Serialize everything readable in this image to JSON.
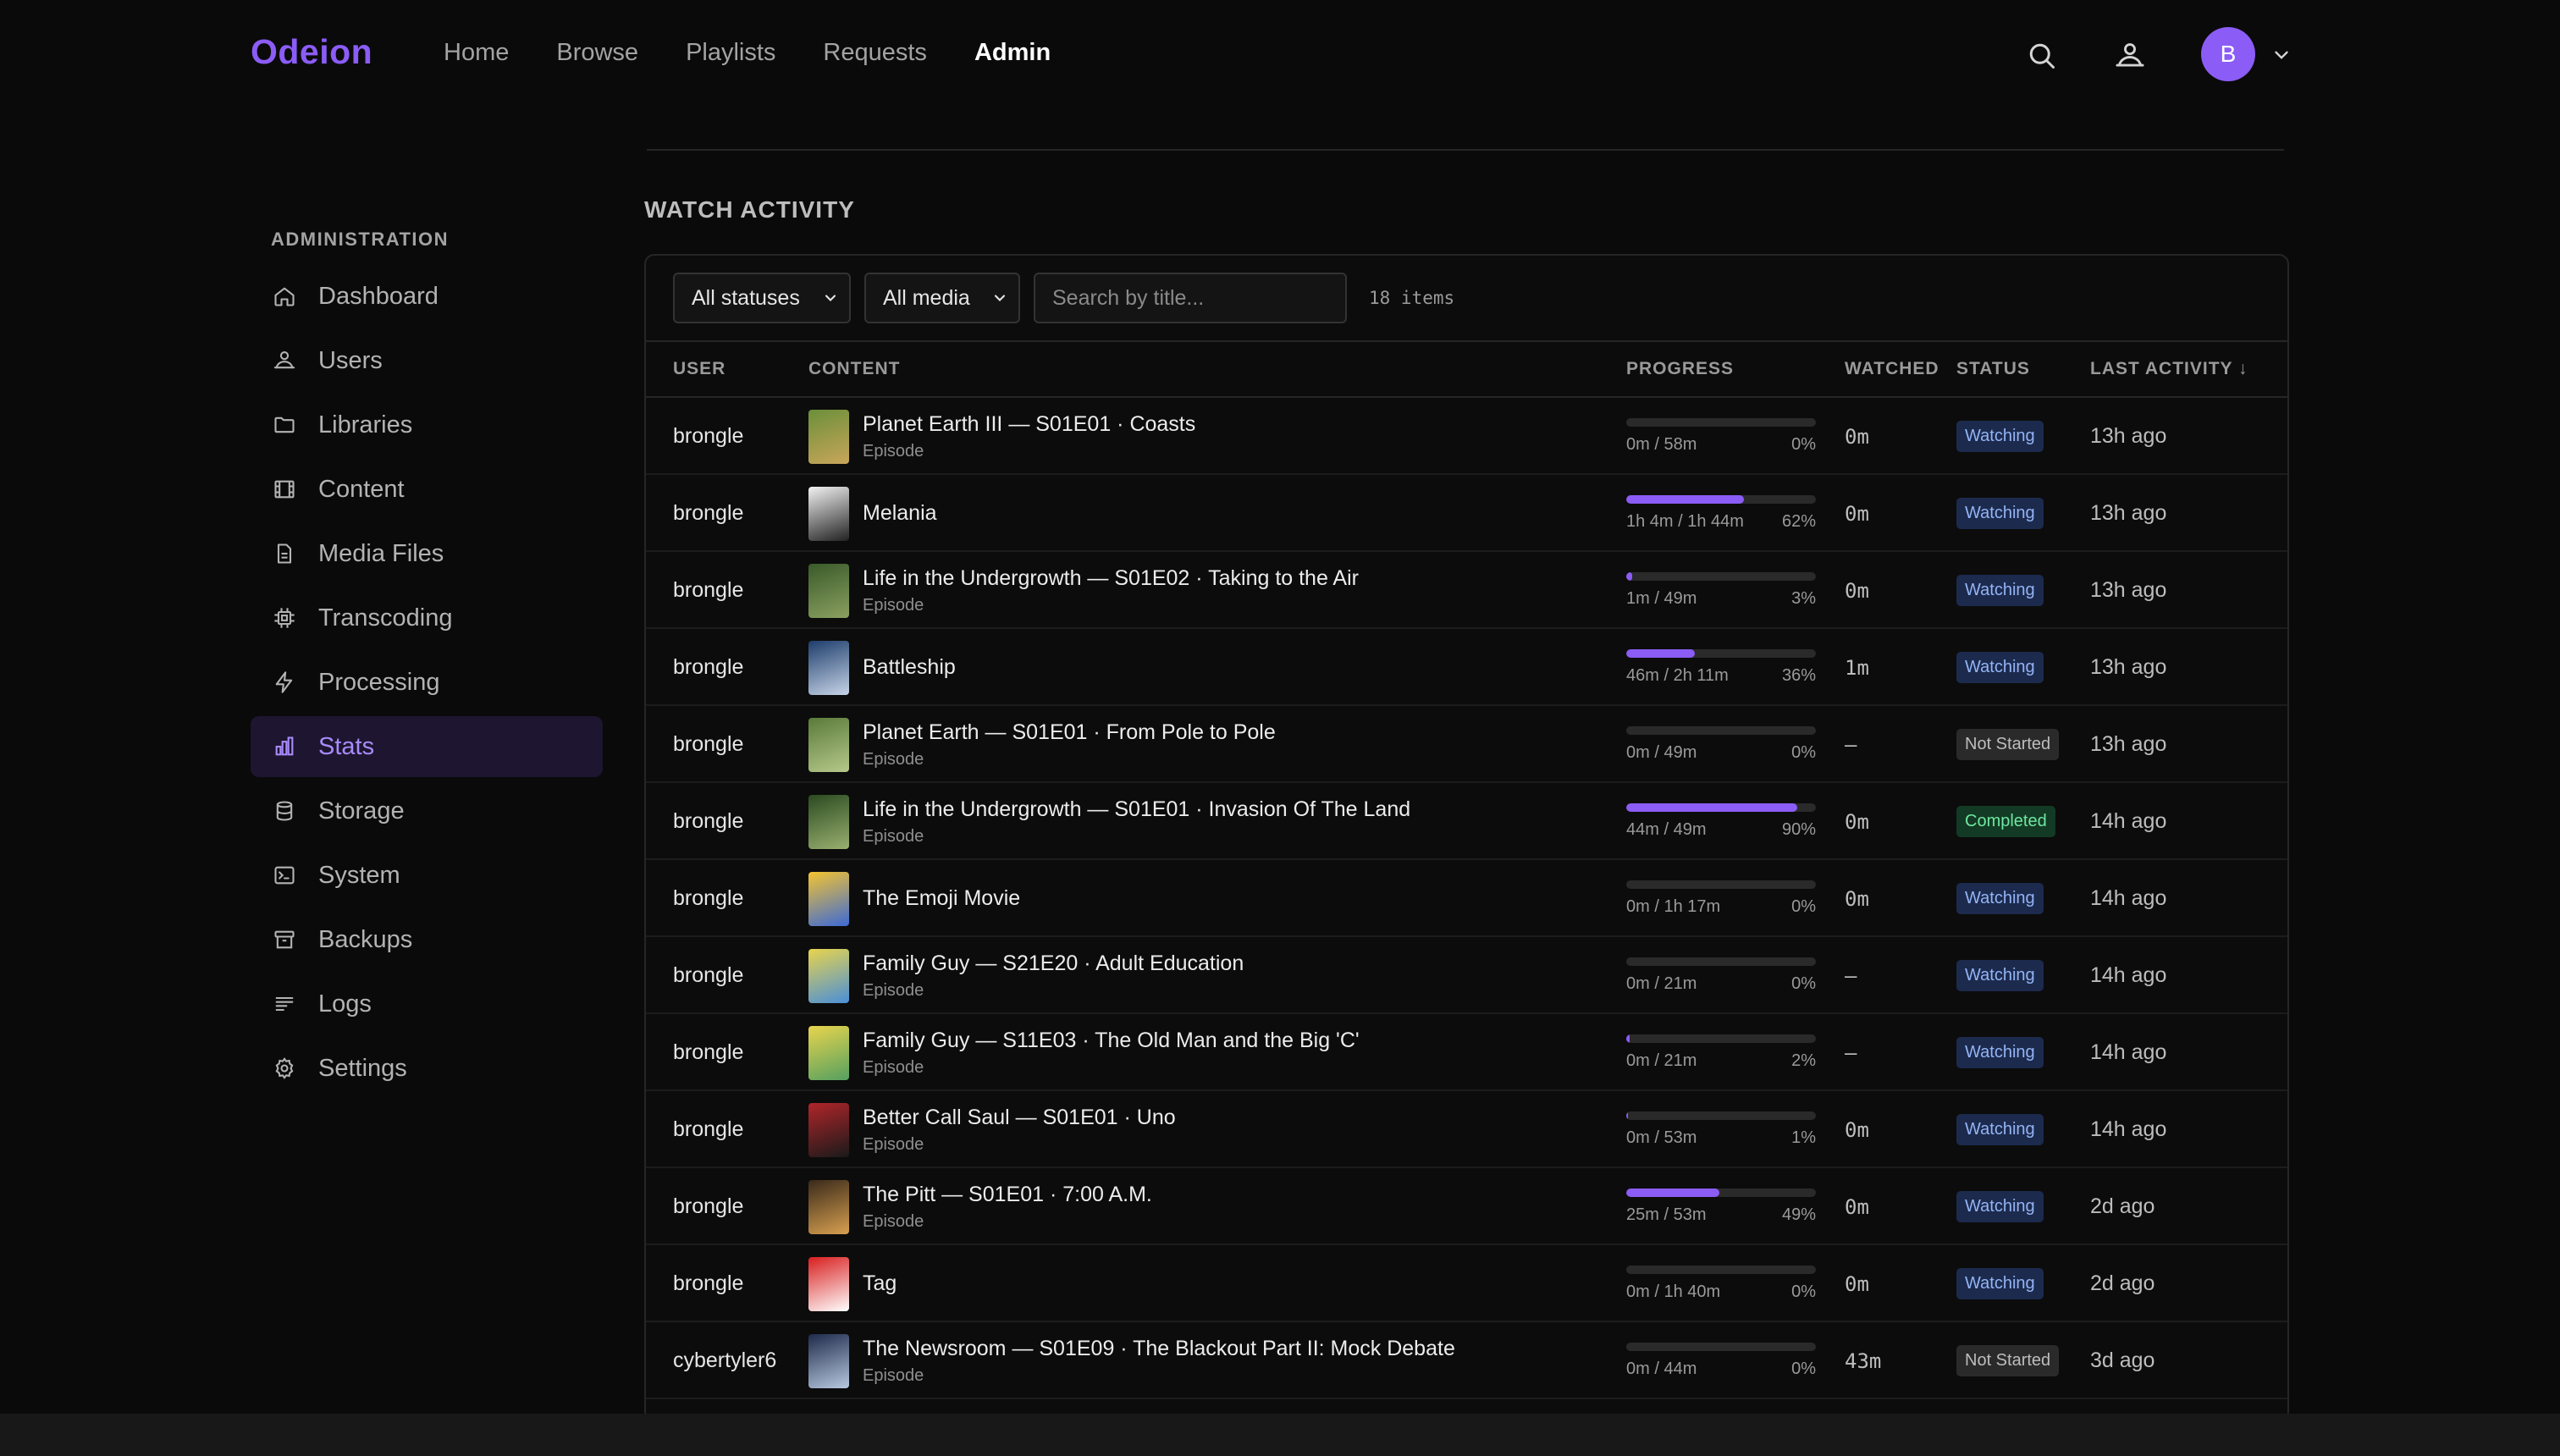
{
  "app": {
    "brand": "Odeion"
  },
  "nav": {
    "links": [
      {
        "label": "Home"
      },
      {
        "label": "Browse"
      },
      {
        "label": "Playlists"
      },
      {
        "label": "Requests"
      },
      {
        "label": "Admin",
        "active": true
      }
    ],
    "avatar_initial": "B"
  },
  "sidebar": {
    "heading": "ADMINISTRATION",
    "items": [
      {
        "label": "Dashboard",
        "icon": "home-icon"
      },
      {
        "label": "Users",
        "icon": "users-icon"
      },
      {
        "label": "Libraries",
        "icon": "folder-icon"
      },
      {
        "label": "Content",
        "icon": "film-icon"
      },
      {
        "label": "Media Files",
        "icon": "file-icon"
      },
      {
        "label": "Transcoding",
        "icon": "chip-icon"
      },
      {
        "label": "Processing",
        "icon": "bolt-icon"
      },
      {
        "label": "Stats",
        "icon": "bar-chart-icon",
        "active": true
      },
      {
        "label": "Storage",
        "icon": "database-icon"
      },
      {
        "label": "System",
        "icon": "terminal-icon"
      },
      {
        "label": "Backups",
        "icon": "archive-icon"
      },
      {
        "label": "Logs",
        "icon": "lines-icon"
      },
      {
        "label": "Settings",
        "icon": "gear-icon"
      }
    ]
  },
  "main": {
    "section_title": "WATCH ACTIVITY",
    "filters": {
      "status_select": "All statuses",
      "media_select": "All media",
      "search_placeholder": "Search by title...",
      "count": "18 items"
    },
    "columns": {
      "user": "USER",
      "content": "CONTENT",
      "progress": "PROGRESS",
      "watched": "WATCHED",
      "status": "STATUS",
      "last_activity": "LAST ACTIVITY ↓"
    },
    "rows": [
      {
        "user": "brongle",
        "title": "Planet Earth III — S01E01 · Coasts",
        "subtitle": "Episode",
        "progress_text": "0m / 58m",
        "percent": "0%",
        "fill": 0,
        "watched": "0m",
        "status": "Watching",
        "last": "13h ago"
      },
      {
        "user": "brongle",
        "title": "Melania",
        "subtitle": "",
        "progress_text": "1h 4m / 1h 44m",
        "percent": "62%",
        "fill": 62,
        "watched": "0m",
        "status": "Watching",
        "last": "13h ago"
      },
      {
        "user": "brongle",
        "title": "Life in the Undergrowth — S01E02 · Taking to the Air",
        "subtitle": "Episode",
        "progress_text": "1m / 49m",
        "percent": "3%",
        "fill": 3,
        "watched": "0m",
        "status": "Watching",
        "last": "13h ago"
      },
      {
        "user": "brongle",
        "title": "Battleship",
        "subtitle": "",
        "progress_text": "46m / 2h 11m",
        "percent": "36%",
        "fill": 36,
        "watched": "1m",
        "status": "Watching",
        "last": "13h ago"
      },
      {
        "user": "brongle",
        "title": "Planet Earth — S01E01 · From Pole to Pole",
        "subtitle": "Episode",
        "progress_text": "0m / 49m",
        "percent": "0%",
        "fill": 0,
        "watched": "—",
        "status": "Not Started",
        "last": "13h ago"
      },
      {
        "user": "brongle",
        "title": "Life in the Undergrowth — S01E01 · Invasion Of The Land",
        "subtitle": "Episode",
        "progress_text": "44m / 49m",
        "percent": "90%",
        "fill": 90,
        "watched": "0m",
        "status": "Completed",
        "last": "14h ago"
      },
      {
        "user": "brongle",
        "title": "The Emoji Movie",
        "subtitle": "",
        "progress_text": "0m / 1h 17m",
        "percent": "0%",
        "fill": 0,
        "watched": "0m",
        "status": "Watching",
        "last": "14h ago"
      },
      {
        "user": "brongle",
        "title": "Family Guy — S21E20 · Adult Education",
        "subtitle": "Episode",
        "progress_text": "0m / 21m",
        "percent": "0%",
        "fill": 0,
        "watched": "—",
        "status": "Watching",
        "last": "14h ago"
      },
      {
        "user": "brongle",
        "title": "Family Guy — S11E03 · The Old Man and the Big 'C'",
        "subtitle": "Episode",
        "progress_text": "0m / 21m",
        "percent": "2%",
        "fill": 2,
        "watched": "—",
        "status": "Watching",
        "last": "14h ago"
      },
      {
        "user": "brongle",
        "title": "Better Call Saul — S01E01 · Uno",
        "subtitle": "Episode",
        "progress_text": "0m / 53m",
        "percent": "1%",
        "fill": 1,
        "watched": "0m",
        "status": "Watching",
        "last": "14h ago"
      },
      {
        "user": "brongle",
        "title": "The Pitt — S01E01 · 7:00 A.M.",
        "subtitle": "Episode",
        "progress_text": "25m / 53m",
        "percent": "49%",
        "fill": 49,
        "watched": "0m",
        "status": "Watching",
        "last": "2d ago"
      },
      {
        "user": "brongle",
        "title": "Tag",
        "subtitle": "",
        "progress_text": "0m / 1h 40m",
        "percent": "0%",
        "fill": 0,
        "watched": "0m",
        "status": "Watching",
        "last": "2d ago"
      },
      {
        "user": "cybertyler6",
        "title": "The Newsroom — S01E09 · The Blackout Part II: Mock Debate",
        "subtitle": "Episode",
        "progress_text": "0m / 44m",
        "percent": "0%",
        "fill": 0,
        "watched": "43m",
        "status": "Not Started",
        "last": "3d ago"
      }
    ]
  },
  "colors": {
    "accent": "#8b5cf6",
    "background": "#0a0a0a",
    "badge_watching": "#1c2a4d",
    "badge_completed": "#133a24"
  }
}
